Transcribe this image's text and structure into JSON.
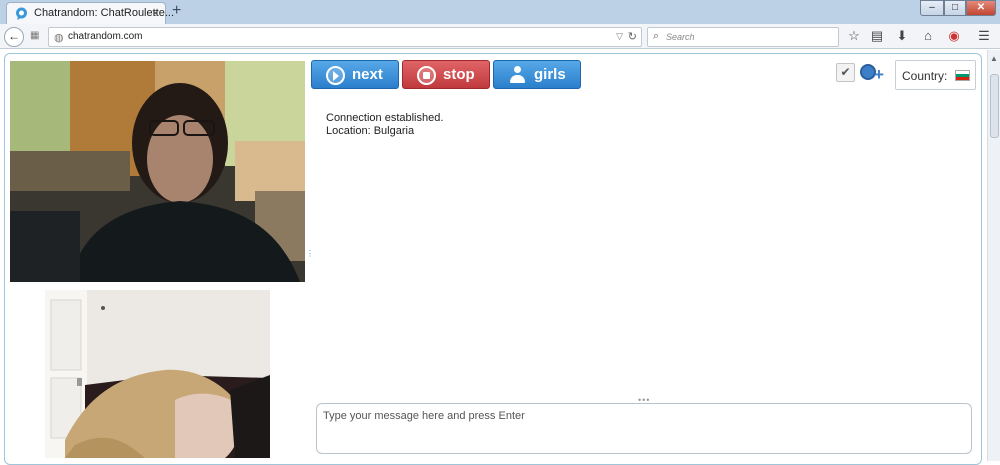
{
  "browser": {
    "tab_title": "Chatrandom: ChatRoulette...",
    "tab_close": "×",
    "new_tab": "+",
    "url": "chatrandom.com",
    "search_placeholder": "Search",
    "window_min": "–",
    "window_max": "□",
    "window_close": "✕"
  },
  "controls": {
    "next_label": "next",
    "stop_label": "stop",
    "girls_label": "girls",
    "country_label": "Country:",
    "country_flag_colors": [
      "#ffffff",
      "#00966e",
      "#d62612"
    ]
  },
  "chat": {
    "status_lines": [
      "Connection established.",
      "Location: Bulgaria"
    ],
    "message_placeholder": "Type your message here and press Enter"
  },
  "colors": {
    "next_button": "#2b7fcb",
    "stop_button": "#c03a3d",
    "girls_button": "#2b7fcb",
    "panel_border": "#9fc5d8"
  },
  "icons": {
    "back": "back-arrow-icon",
    "favicon": "chat-bubble-icon",
    "bookmark": "star-icon",
    "reading_list": "clipboard-icon",
    "downloads": "download-icon",
    "home": "home-icon",
    "addon": "addon-icon",
    "menu": "hamburger-icon",
    "confirm": "checkmark-icon",
    "add_friend": "add-user-icon"
  }
}
